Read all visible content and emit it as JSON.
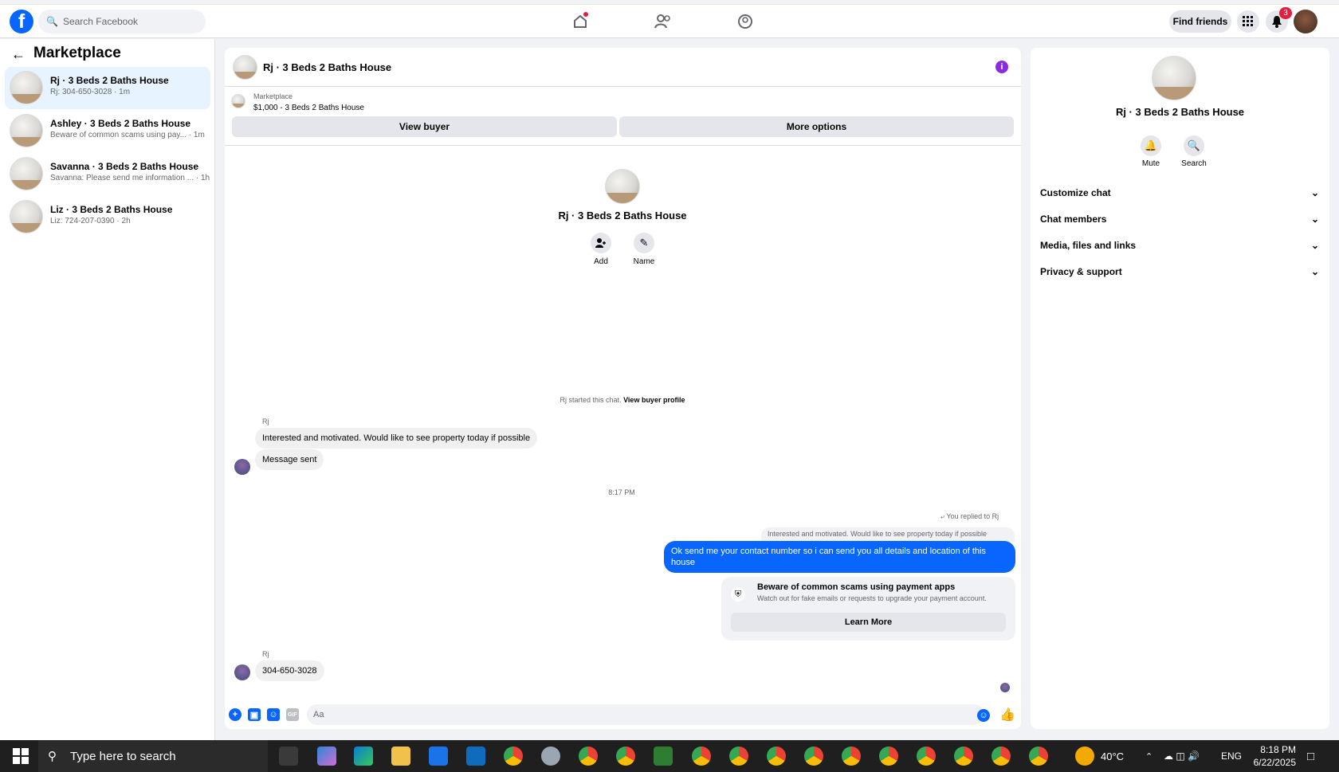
{
  "topbar": {
    "search_placeholder": "Search Facebook",
    "find_friends": "Find friends",
    "notif_count": "3"
  },
  "sidebar": {
    "title": "Marketplace",
    "conversations": [
      {
        "name": "Rj · 3 Beds 2 Baths House",
        "preview": "Rj: 304-650-3028 · 1m"
      },
      {
        "name": "Ashley · 3 Beds 2 Baths House",
        "preview": "Beware of common scams using pay... · 1m"
      },
      {
        "name": "Savanna · 3 Beds 2 Baths House",
        "preview": "Savanna: Please send me information ... · 1h"
      },
      {
        "name": "Liz · 3 Beds 2 Baths House",
        "preview": "Liz: 724-207-0390 · 2h"
      }
    ]
  },
  "chat": {
    "title": "Rj · 3 Beds 2 Baths House",
    "marketplace_label": "Marketplace",
    "listing": "$1,000 - 3 Beds 2 Baths House",
    "view_buyer": "View buyer",
    "more_options": "More options",
    "profile_title": "Rj · 3 Beds 2 Baths House",
    "add_label": "Add",
    "name_label": "Name",
    "system_msg": "Rj started this chat.",
    "system_link": "View buyer profile",
    "sender1": "Rj",
    "msg1": "Interested and motivated. Would like to see  property today if possible",
    "msg2": "Message sent",
    "timestamp": "8:17 PM",
    "replied_label": "You replied to Rj",
    "quoted": "Interested and motivated. Would like to see  property today if possible",
    "outgoing": "Ok send me your contact number so i can send you all details and location of this house",
    "scam_title": "Beware of common scams using payment apps",
    "scam_sub": "Watch out for fake emails or requests to upgrade your payment account.",
    "learn_more": "Learn More",
    "sender2": "Rj",
    "msg3": "304-650-3028",
    "composer_placeholder": "Aa"
  },
  "details": {
    "title": "Rj · 3 Beds 2 Baths House",
    "mute": "Mute",
    "search": "Search",
    "sections": [
      "Customize chat",
      "Chat members",
      "Media, files and links",
      "Privacy & support"
    ]
  },
  "taskbar": {
    "search": "Type here to search",
    "weather": "40°C",
    "lang": "ENG",
    "time": "8:18 PM",
    "date": "6/22/2025"
  },
  "colors": {
    "accent": "#0866ff",
    "info": "#8a2be2",
    "badge": "#e41e3f"
  }
}
